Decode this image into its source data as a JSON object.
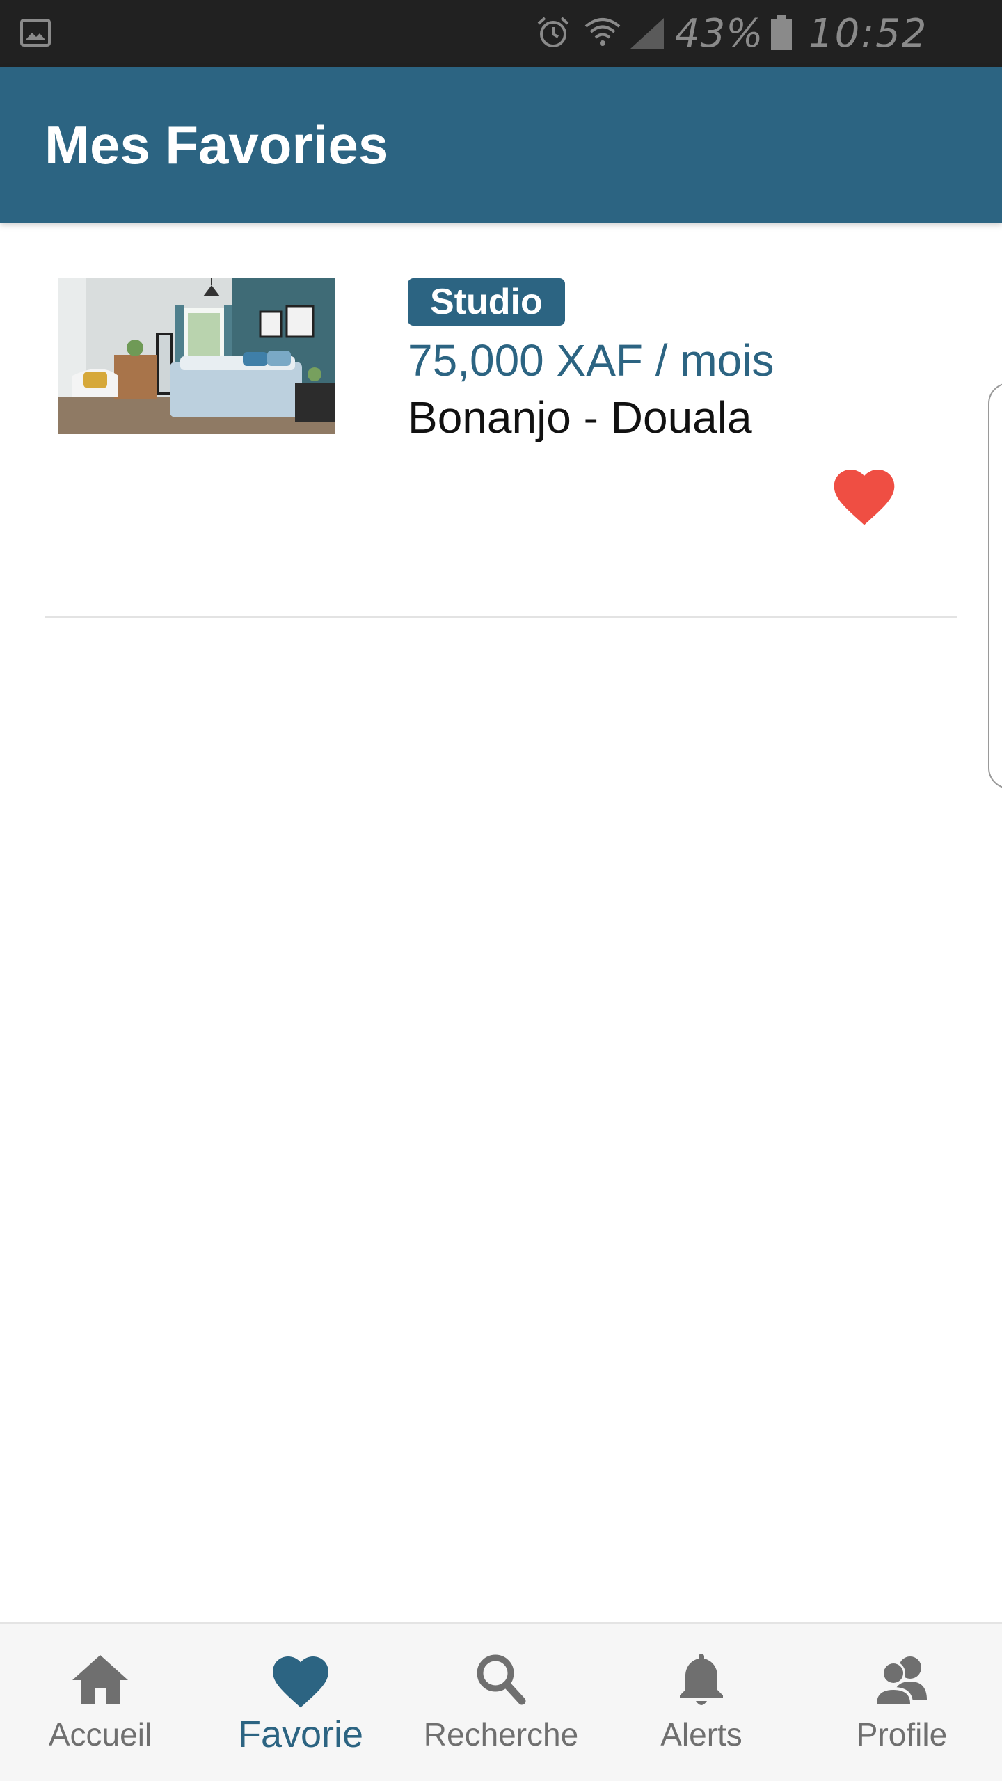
{
  "status_bar": {
    "battery": "43%",
    "time": "10:52 AM",
    "icons": [
      "gallery-icon",
      "alarm-icon",
      "wifi-icon",
      "signal-icon",
      "battery-icon"
    ]
  },
  "header": {
    "title": "Mes Favories"
  },
  "favorites": [
    {
      "type": "Studio",
      "price": "75,000 XAF / mois",
      "location": "Bonanjo - Douala",
      "favorited": true,
      "image": "bedroom-photo"
    }
  ],
  "bottom_nav": {
    "items": [
      {
        "label": "Accueil",
        "icon": "home-icon"
      },
      {
        "label": "Favorie",
        "icon": "heart-icon",
        "active": true
      },
      {
        "label": "Recherche",
        "icon": "search-icon"
      },
      {
        "label": "Alerts",
        "icon": "bell-icon"
      },
      {
        "label": "Profile",
        "icon": "users-icon"
      }
    ]
  },
  "colors": {
    "primary": "#2c6482",
    "heart": "#ef4e43",
    "status_bar": "#212121",
    "nav_inactive": "#6f6f6f"
  }
}
